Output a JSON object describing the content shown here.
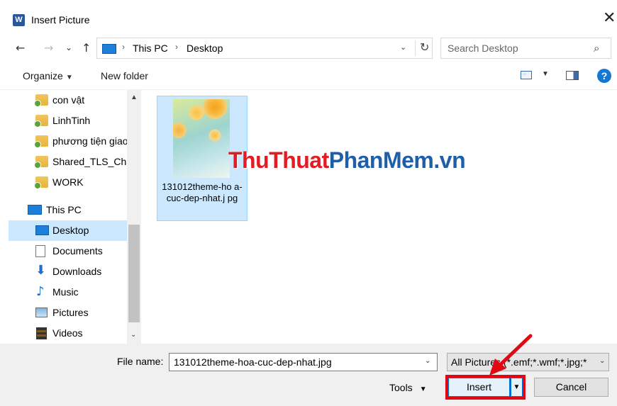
{
  "window": {
    "title": "Insert Picture",
    "app_icon_letter": "W",
    "close_glyph": "✕"
  },
  "nav": {
    "back_glyph": "←",
    "forward_glyph": "→",
    "recent_glyph": "⌄",
    "up_glyph": "↑",
    "breadcrumb": [
      "This PC",
      "Desktop"
    ],
    "breadcrumb_sep": "›",
    "refresh_glyph": "↻",
    "dropdown_glyph": "⌄",
    "search_placeholder": "Search Desktop",
    "search_glyph": "⌕"
  },
  "toolbar": {
    "organize": "Organize",
    "organize_caret": "▼",
    "new_folder": "New folder",
    "view_caret": "▼",
    "help": "?"
  },
  "sidebar": {
    "items": [
      {
        "label": "con vật",
        "icon": "folder-icon"
      },
      {
        "label": "LinhTinh",
        "icon": "folder-icon"
      },
      {
        "label": "phương tiện giao",
        "icon": "folder-icon"
      },
      {
        "label": "Shared_TLS_Cha",
        "icon": "shared-folder-icon"
      },
      {
        "label": "WORK",
        "icon": "folder-icon"
      },
      {
        "label": "This PC",
        "icon": "pc-icon"
      },
      {
        "label": "Desktop",
        "icon": "desktop-icon"
      },
      {
        "label": "Documents",
        "icon": "documents-icon"
      },
      {
        "label": "Downloads",
        "icon": "downloads-icon"
      },
      {
        "label": "Music",
        "icon": "music-icon"
      },
      {
        "label": "Pictures",
        "icon": "pictures-icon"
      },
      {
        "label": "Videos",
        "icon": "videos-icon"
      }
    ],
    "selected": "Desktop",
    "scroll_up": "▲",
    "scroll_down": "⌄"
  },
  "content": {
    "file": {
      "name": "131012theme-hoa-cuc-dep-nhat.jpg",
      "name_display": "131012theme-ho a-cuc-dep-nhat.j pg"
    }
  },
  "watermark": {
    "part1": "Thu",
    "part2": "Thuat",
    "part3": "PhanMem",
    "part4": ".vn"
  },
  "bottom": {
    "file_name_label": "File name:",
    "file_name_value": "131012theme-hoa-cuc-dep-nhat.jpg",
    "file_name_dd": "⌄",
    "filter_value": "All Pictures (*.emf;*.wmf;*.jpg;*",
    "filter_dd": "⌄",
    "tools": "Tools",
    "tools_caret": "▼",
    "insert": "Insert",
    "insert_split": "▼",
    "cancel": "Cancel"
  },
  "colors": {
    "accent_red": "#e30613",
    "selection": "#cce8ff",
    "watermark_red": "#e31b23",
    "watermark_blue": "#1f5ea8"
  }
}
